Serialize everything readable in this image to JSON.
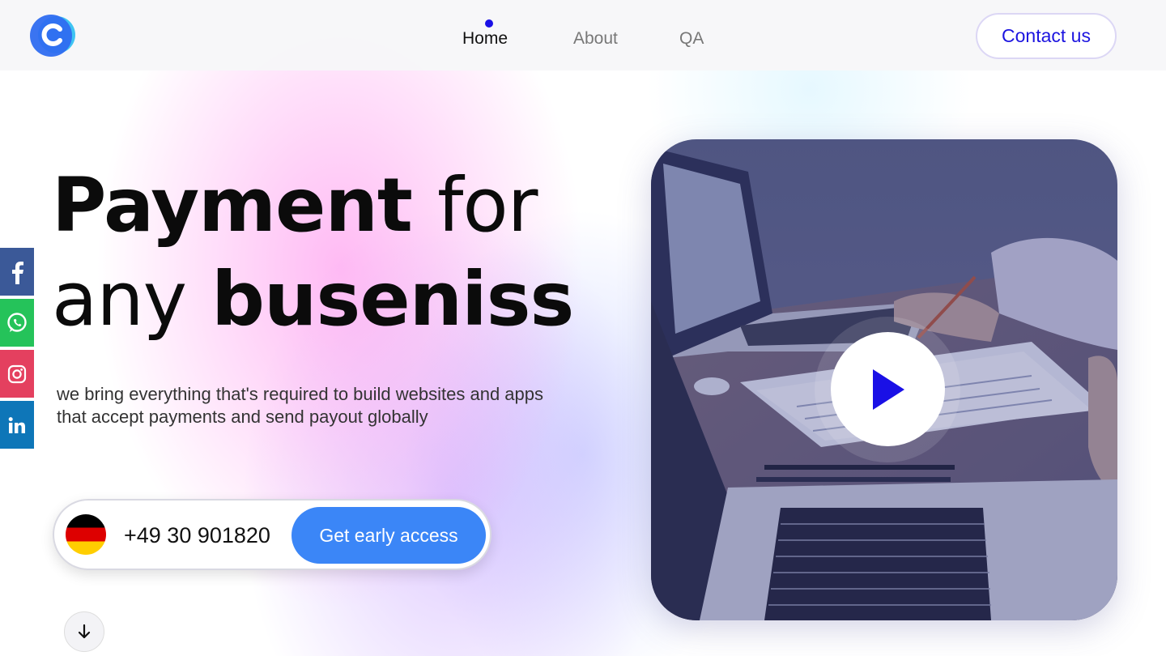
{
  "brand": {
    "accent": "#1c14e0",
    "button_blue": "#3b86f7",
    "logo_icon": "c-logo-icon"
  },
  "nav": {
    "items": [
      {
        "label": "Home",
        "active": true
      },
      {
        "label": "About",
        "active": false
      },
      {
        "label": "QA",
        "active": false
      }
    ],
    "contact_label": "Contact us"
  },
  "hero": {
    "title_line1_bold": "Payment",
    "title_line1_normal": "for",
    "title_line2_normal": "any",
    "title_line2_bold": "buseniss",
    "subtitle_line1": "we bring everything that's required to build websites and apps",
    "subtitle_line2": "that accept payments and send payout globally"
  },
  "social": [
    {
      "icon": "facebook-icon",
      "color": "#3b5998"
    },
    {
      "icon": "whatsapp-icon",
      "color": "#25c35a"
    },
    {
      "icon": "instagram-icon",
      "color": "#e4405f"
    },
    {
      "icon": "linkedin-icon",
      "color": "#0e76b8"
    }
  ],
  "signup": {
    "flag_icon": "germany-flag-icon",
    "phone": "+49 30 901820",
    "cta_label": "Get early access"
  },
  "scroll": {
    "icon": "arrow-down-icon"
  },
  "video": {
    "icon": "play-icon"
  }
}
